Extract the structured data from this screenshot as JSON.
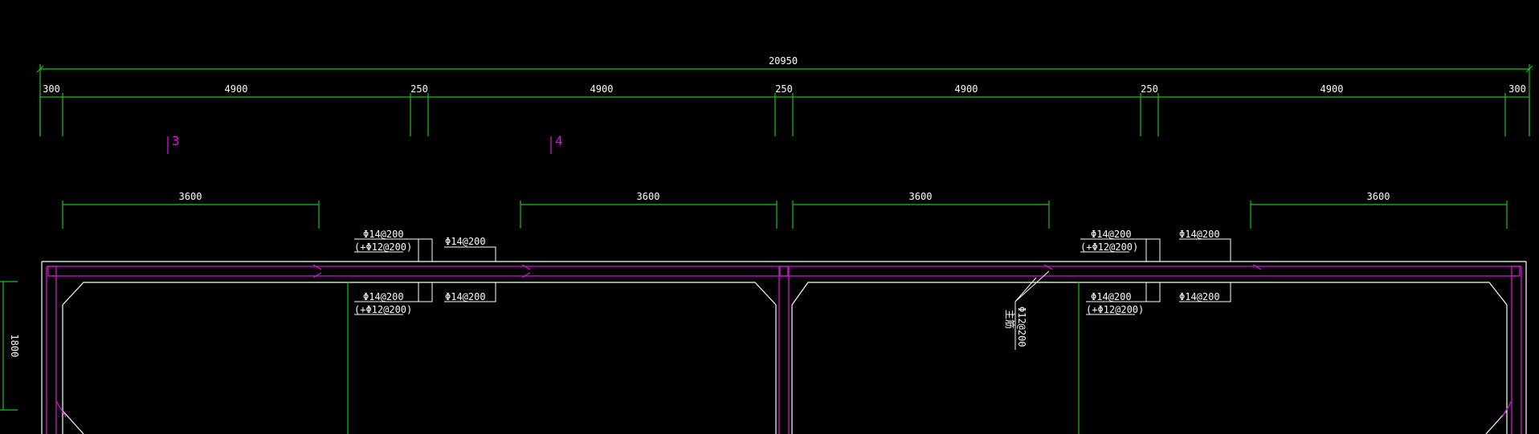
{
  "dimensions": {
    "overall": "20950",
    "segments": [
      "300",
      "4900",
      "250",
      "4900",
      "250",
      "4900",
      "250",
      "4900",
      "300"
    ],
    "spans": [
      "3600",
      "3600",
      "3600",
      "3600"
    ],
    "height": "1800"
  },
  "section_marks": [
    "3",
    "4"
  ],
  "rebar_labels": {
    "top_main": "Φ14@200",
    "top_add": "(+Φ12@200)",
    "top_dist": "Φ14@200",
    "bot_main": "Φ14@200",
    "bot_add": "(+Φ12@200)",
    "bot_dist": "Φ14@200",
    "haunch": "Φ12@200",
    "haunch_note": "主筋"
  },
  "colors": {
    "dimension": "#19c219",
    "wall": "#ffffff",
    "rebar": "#d018d0",
    "background": "#000000"
  }
}
